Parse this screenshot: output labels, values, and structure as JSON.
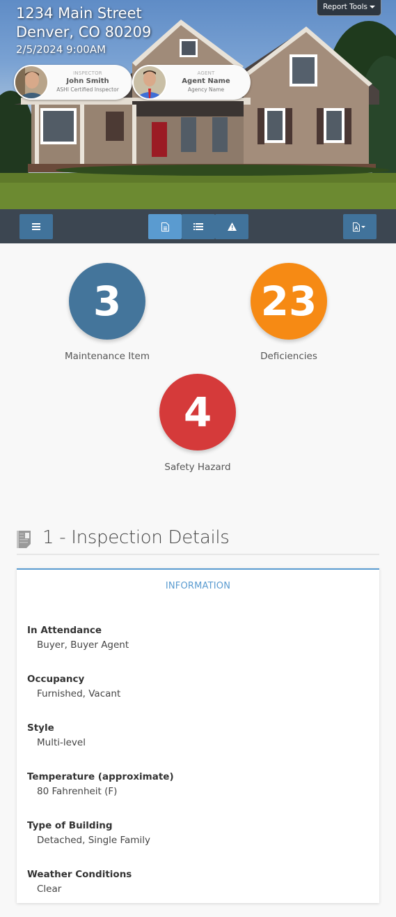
{
  "header": {
    "address_line1": "1234 Main Street",
    "address_line2": "Denver, CO 80209",
    "datetime": "2/5/2024 9:00AM",
    "report_tools_label": "Report Tools"
  },
  "inspector": {
    "role": "INSPECTOR",
    "name": "John Smith",
    "subtitle": "ASHI Certified Inspector"
  },
  "agent": {
    "role": "AGENT",
    "name": "Agent Name",
    "subtitle": "Agency Name"
  },
  "toolbar": {
    "buttons": [
      {
        "icon": "menu-icon",
        "active": false
      },
      {
        "icon": "document-icon",
        "active": true
      },
      {
        "icon": "list-icon",
        "active": false
      },
      {
        "icon": "warning-icon",
        "active": false
      },
      {
        "icon": "pdf-icon",
        "active": false,
        "dropdown": true
      }
    ]
  },
  "stats": [
    {
      "value": "3",
      "label": "Maintenance Item",
      "color": "#44759b"
    },
    {
      "value": "23",
      "label": "Deficiencies",
      "color": "#f68a14"
    },
    {
      "value": "4",
      "label": "Safety Hazard",
      "color": "#d53a3a"
    }
  ],
  "section": {
    "title": "1 - Inspection Details",
    "card_title": "INFORMATION",
    "items": [
      {
        "label": "In Attendance",
        "value": "Buyer, Buyer Agent"
      },
      {
        "label": "Occupancy",
        "value": "Furnished, Vacant"
      },
      {
        "label": "Style",
        "value": "Multi-level"
      },
      {
        "label": "Temperature (approximate)",
        "value": "80 Fahrenheit (F)"
      },
      {
        "label": "Type of Building",
        "value": "Detached, Single Family"
      },
      {
        "label": "Weather Conditions",
        "value": "Clear"
      }
    ]
  },
  "colors": {
    "toolbar_bg": "#3c4651",
    "button": "#41739b",
    "button_active": "#5a9bd0",
    "accent": "#5a9bd0"
  }
}
